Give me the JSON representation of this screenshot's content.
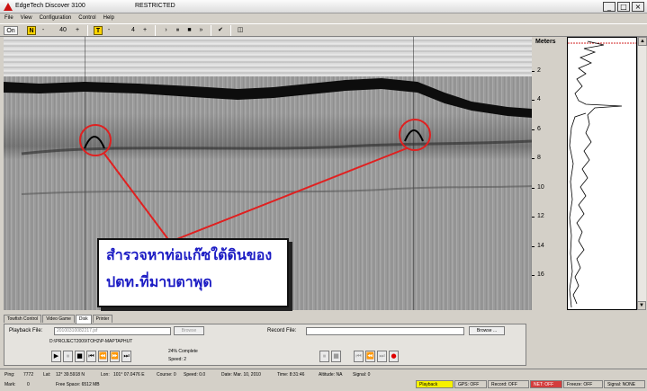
{
  "window": {
    "title": "EdgeTech Discover 3100",
    "status": "RESTRICTED",
    "min": "_",
    "max": "□",
    "close": "×"
  },
  "menu": [
    "File",
    "View",
    "Configuration",
    "Control",
    "Help"
  ],
  "toolbar": {
    "on_label": "On",
    "n_label": "N",
    "n_minus": "-",
    "n_value": "40",
    "n_plus": "+",
    "t_label": "T",
    "t_minus": "-",
    "t_value": "4",
    "t_plus": "+",
    "next": "›",
    "pause": "⏸",
    "stop": "■",
    "fast_forward": "»",
    "check": "✔",
    "panel": "◫"
  },
  "depth_scale": {
    "label": "Meters",
    "ticks": [
      "2",
      "4",
      "6",
      "8",
      "10",
      "12",
      "14",
      "16"
    ]
  },
  "annotation": {
    "line1": "สำรวจหาท่อแก๊ซใต้ดินของ",
    "line2": "ปตท.ที่มาบตาพุด",
    "circle_color": "#e02020"
  },
  "tabs": [
    "Towfish Control",
    "Video Game",
    "Disk",
    "Printer"
  ],
  "disk": {
    "playback_label": "Playback File:",
    "playback_value": "20100310082217.jsf",
    "browse_disabled": "Browse",
    "record_label": "Record File:",
    "record_value": "",
    "browse": "Browse ...",
    "path": "D:\\PROJECT2009\\TOH2\\P-MAPTAPHUT",
    "complete": "24% Complete",
    "speed": "Speed: 2",
    "play_buttons": [
      "▶",
      "⏸",
      "■",
      "⏮",
      "⏪",
      "⏩",
      "⏭"
    ],
    "rec_buttons": [
      "⏸",
      "■",
      "⏮",
      "⏪",
      "⏭",
      "●"
    ]
  },
  "status": {
    "ping": "Ping:",
    "ping_val": "7772",
    "lat": "Lat:",
    "lat_val": "12° 39.5918 N",
    "lon": "Lon:",
    "lon_val": "101° 07.0476 E",
    "course": "Course: 0",
    "speed": "Speed: 0.0",
    "date": "Date: Mar. 10, 2010",
    "time": "Time: 8:31:46",
    "altitude": "Altitude: NA",
    "signal": "Signal: 0",
    "mark": "Mark:",
    "mark_val": "0",
    "free": "Free Space: 6512 MB",
    "playback": "Playback",
    "gps": "GPS: OFF",
    "record": "Record: OFF",
    "net": "NET: OFF",
    "freeze": "Freeze: OFF",
    "signal2": "Signal: NONE"
  },
  "colors": {
    "playback": "#f6f200",
    "net": "#d43c3c",
    "callout_text": "#1c1cc4",
    "circle": "#e02020"
  }
}
